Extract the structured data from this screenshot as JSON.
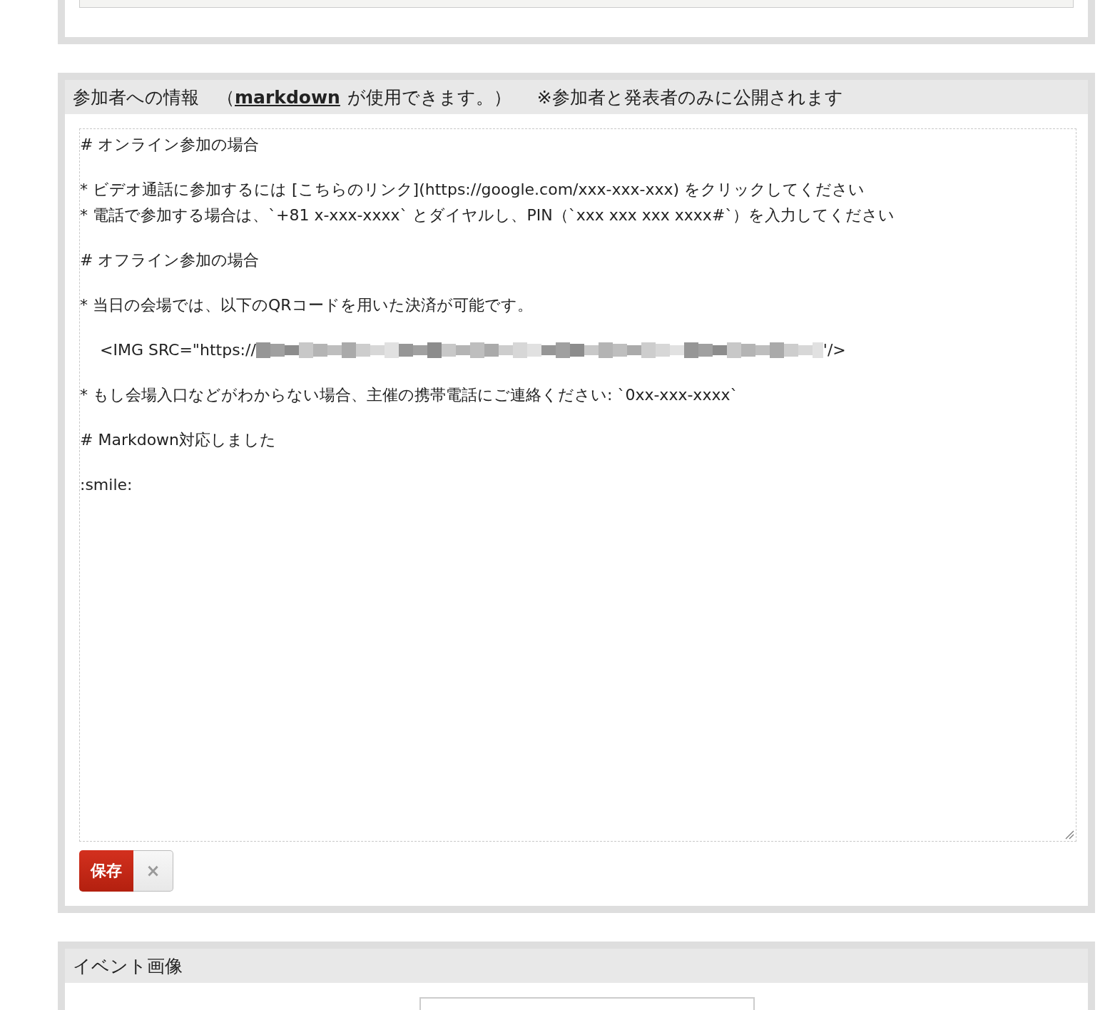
{
  "top_panel": {
    "kind": "field"
  },
  "info_panel": {
    "prefix": "参加者への情報　（",
    "link": "markdown",
    "suffix": "が使用できます。）",
    "note": "※参加者と発表者のみに公開されます",
    "paragraphs": [
      [
        {
          "kind": "text",
          "text": "# オンライン参加の場合"
        }
      ],
      [
        {
          "kind": "text",
          "text": "* ビデオ通話に参加するには [こちらのリンク](https://google.com/xxx-xxx-xxx) をクリックしてください"
        },
        {
          "kind": "text",
          "text": "* 電話で参加する場合は、`+81 x-xxx-xxxx` とダイヤルし、PIN（`xxx xxx xxx xxxx#`）を入力してください"
        }
      ],
      [
        {
          "kind": "text",
          "text": "# オフライン参加の場合"
        }
      ],
      [
        {
          "kind": "text",
          "text": "* 当日の会場では、以下のQRコードを用いた決済が可能です。"
        }
      ],
      [
        {
          "kind": "redacted",
          "text": "    <IMG SRC=\"https://",
          "after": "'/>"
        }
      ],
      [
        {
          "kind": "text",
          "text": "* もし会場入口などがわからない場合、主催の携帯電話にご連絡ください: `0xx-xxx-xxxx`"
        }
      ],
      [
        {
          "kind": "text",
          "text": "# Markdown対応しました"
        }
      ],
      [
        {
          "kind": "text",
          "text": ":smile:"
        }
      ]
    ],
    "save_label": "保存",
    "cancel_label": "×"
  },
  "image_panel": {
    "title": "イベント画像"
  }
}
